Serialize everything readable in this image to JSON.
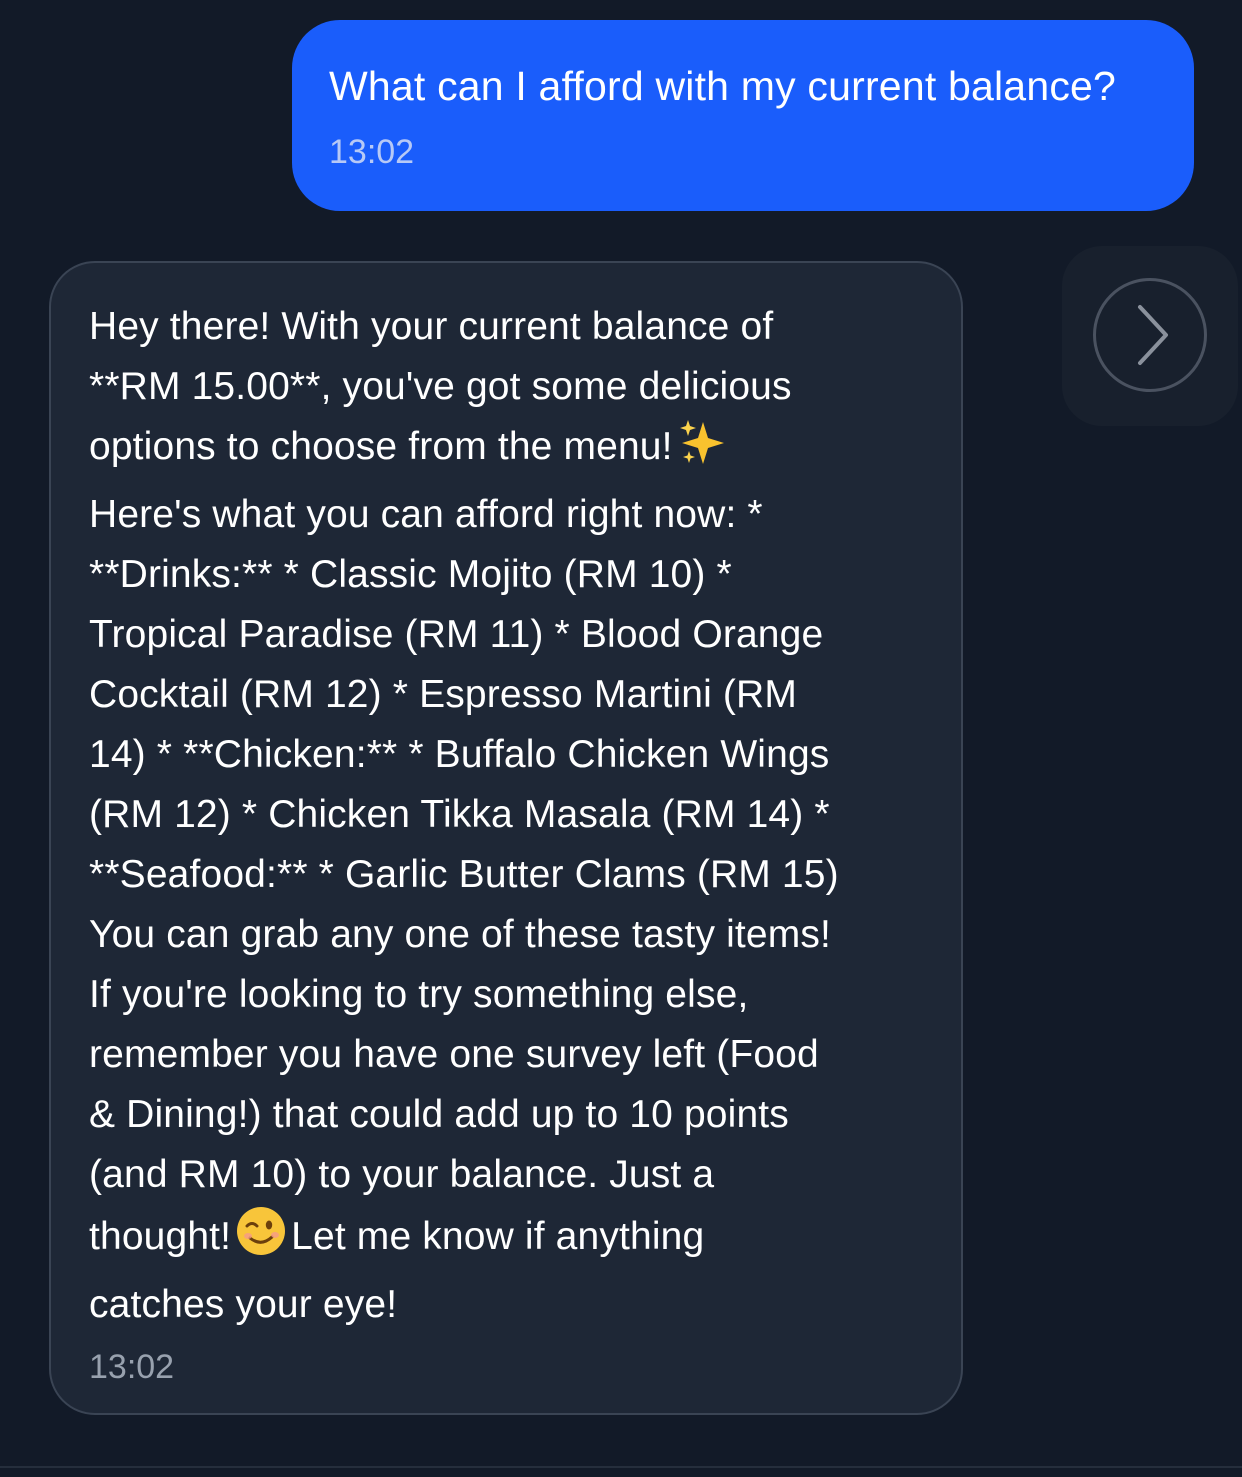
{
  "messages": {
    "user": {
      "text": "What can I afford with my current balance?",
      "time": "13:02"
    },
    "bot": {
      "lines": [
        "Hey there! With your current balance of",
        "**RM 15.00**, you've got some delicious",
        "options to choose from the menu!",
        "Here's what you can afford right now: *",
        "**Drinks:** * Classic Mojito (RM 10) *",
        "Tropical Paradise (RM 11) * Blood Orange",
        "Cocktail (RM 12) * Espresso Martini (RM",
        "14) * **Chicken:** * Buffalo Chicken Wings",
        "(RM 12) * Chicken Tikka Masala (RM 14) *",
        "**Seafood:** * Garlic Butter Clams (RM 15)",
        "You can grab any one of these tasty items!",
        "If you're looking to try something else,",
        "remember you have one survey left (Food",
        "& Dining!) that could add up to 10 points",
        "(and RM 10) to your balance. Just a",
        "thought!",
        "Let me know if anything",
        "catches your eye!"
      ],
      "time": "13:02",
      "emojis": [
        "sparkles-icon",
        "winking-face-icon"
      ]
    }
  },
  "colors": {
    "background": "#121a28",
    "user_bubble": "#1a5dfb",
    "bot_bubble": "#1e2736"
  },
  "icons": {
    "next": "chevron-right-icon"
  }
}
